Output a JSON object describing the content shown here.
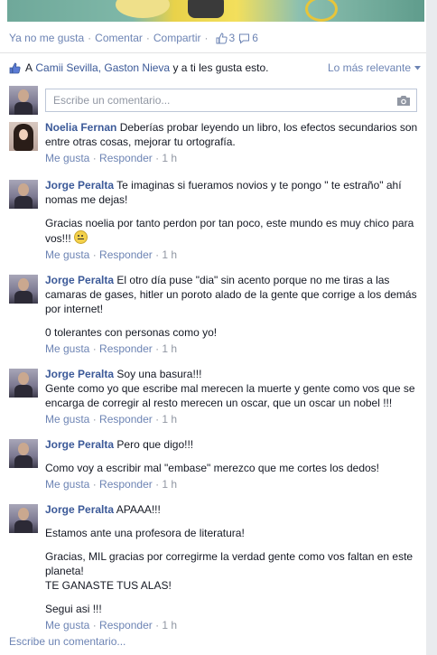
{
  "actions": {
    "unlike": "Ya no me gusta",
    "comment": "Comentar",
    "share": "Compartir",
    "likes_count": "3",
    "comments_count": "6"
  },
  "likers": {
    "prefix": "A",
    "names": "Camii Sevilla, Gaston Nieva",
    "suffix": "y a ti les gusta esto.",
    "sort_label": "Lo más relevante"
  },
  "comment_input": {
    "placeholder": "Escribe un comentario..."
  },
  "comments": [
    {
      "author": "Noelia Fernan",
      "paragraphs": [
        "Deberías probar leyendo un libro, los efectos secundarios son entre otras cosas, mejorar tu ortografía."
      ],
      "like": "Me gusta",
      "reply": "Responder",
      "time": "1 h"
    },
    {
      "author": "Jorge Peralta",
      "paragraphs": [
        "Te imaginas si fueramos novios y te pongo \" te estraño\" ahí nomas me dejas!",
        "Gracias noelia por tanto perdon por tan poco, este mundo es muy chico para vos!!!"
      ],
      "like": "Me gusta",
      "reply": "Responder",
      "time": "1 h"
    },
    {
      "author": "Jorge Peralta",
      "paragraphs": [
        "El otro día puse \"dia\" sin acento porque no me tiras a las camaras de gases, hitler un poroto alado de la gente que corrige a los demás por internet!",
        "0 tolerantes con personas como yo!"
      ],
      "like": "Me gusta",
      "reply": "Responder",
      "time": "1 h"
    },
    {
      "author": "Jorge Peralta",
      "paragraphs": [
        "Soy una basura!!!\nGente como yo que escribe mal merecen la muerte y gente como vos que se encarga de corregir al resto merecen un oscar, que un oscar un nobel !!!"
      ],
      "like": "Me gusta",
      "reply": "Responder",
      "time": "1 h"
    },
    {
      "author": "Jorge Peralta",
      "paragraphs": [
        "Pero que digo!!!",
        "Como voy a escribir mal \"embase\" merezco que me cortes los dedos!"
      ],
      "like": "Me gusta",
      "reply": "Responder",
      "time": "1 h"
    },
    {
      "author": "Jorge Peralta",
      "paragraphs": [
        "APAAA!!!",
        "Estamos ante una profesora de literatura!",
        "Gracias, MIL gracias por corregirme la verdad gente como vos faltan en este planeta!\nTE GANASTE TUS ALAS!",
        "Segui asi !!!"
      ],
      "like": "Me gusta",
      "reply": "Responder",
      "time": "1 h"
    }
  ],
  "bottom_input": {
    "label": "Escribe un comentario..."
  },
  "colors": {
    "link": "#3b5998",
    "meta_link": "#6d84b4",
    "muted": "#9197a3",
    "border": "#bdc7d8"
  },
  "icons": {
    "like": "thumbs-up-icon",
    "comment": "speech-bubble-icon",
    "camera": "camera-icon",
    "sort": "caret-down-icon"
  }
}
